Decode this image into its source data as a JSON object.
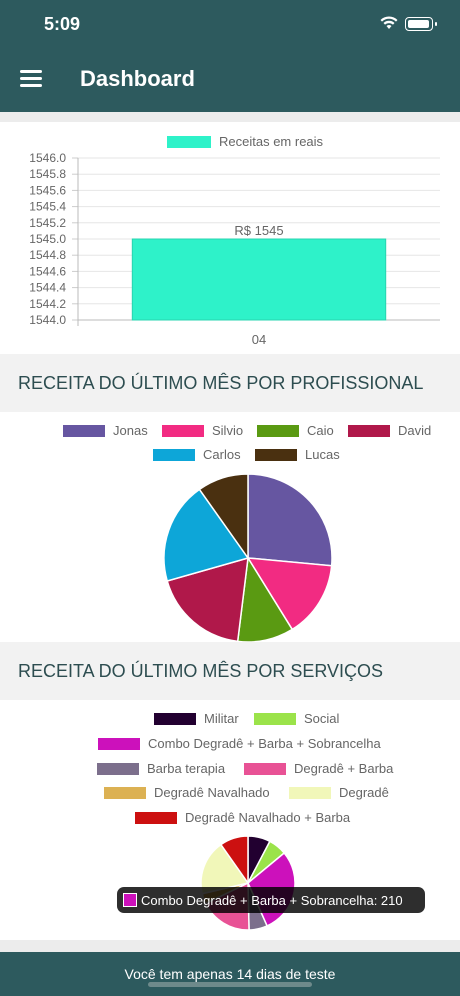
{
  "status_bar": {
    "time": "5:09"
  },
  "header": {
    "title": "Dashboard"
  },
  "revenue_chart": {
    "legend": "Receitas em reais",
    "bar_label": "R$ 1545"
  },
  "section_professional": {
    "title": "RECEITA DO ÚLTIMO MÊS POR PROFISSIONAL"
  },
  "section_services": {
    "title": "RECEITA DO ÚLTIMO MÊS POR SERVIÇOS"
  },
  "tooltip": {
    "text": "Combo Degradê + Barba + Sobrancelha: 210",
    "color": "#cc11bb"
  },
  "footer": {
    "text": "Você tem apenas 14 dias de teste"
  },
  "chart_data": [
    {
      "type": "bar",
      "categories": [
        "04"
      ],
      "series": [
        {
          "name": "Receitas em reais",
          "values": [
            1545
          ],
          "color": "#2ef2c9"
        }
      ],
      "ylim": [
        1544.0,
        1546.0
      ],
      "yticks": [
        "1546.0",
        "1545.8",
        "1545.6",
        "1545.4",
        "1545.2",
        "1545.0",
        "1544.8",
        "1544.6",
        "1544.4",
        "1544.2",
        "1544.0"
      ],
      "data_label": "R$ 1545",
      "legend": "top"
    },
    {
      "type": "pie",
      "labels": [
        "Jonas",
        "Silvio",
        "Caio",
        "David",
        "Carlos",
        "Lucas"
      ],
      "colors": [
        "#6656a1",
        "#f22b82",
        "#5a9a12",
        "#b0184a",
        "#0da6d8",
        "#4a3010"
      ],
      "values": [
        27,
        15,
        11,
        19,
        20,
        10
      ],
      "legend": "top"
    },
    {
      "type": "pie",
      "labels": [
        "Militar",
        "Social",
        "Combo Degradê + Barba + Sobrancelha",
        "Barba terapia",
        "Degradê + Barba",
        "Degradê Navalhado",
        "Degradê",
        "Degradê Navalhado + Barba"
      ],
      "colors": [
        "#220030",
        "#9be34a",
        "#cc11bb",
        "#7c6f8c",
        "#e85295",
        "#dcb153",
        "#f1f7b9",
        "#cc1010"
      ],
      "values": [
        55,
        45,
        210,
        45,
        130,
        25,
        135,
        70
      ],
      "legend": "top"
    }
  ]
}
